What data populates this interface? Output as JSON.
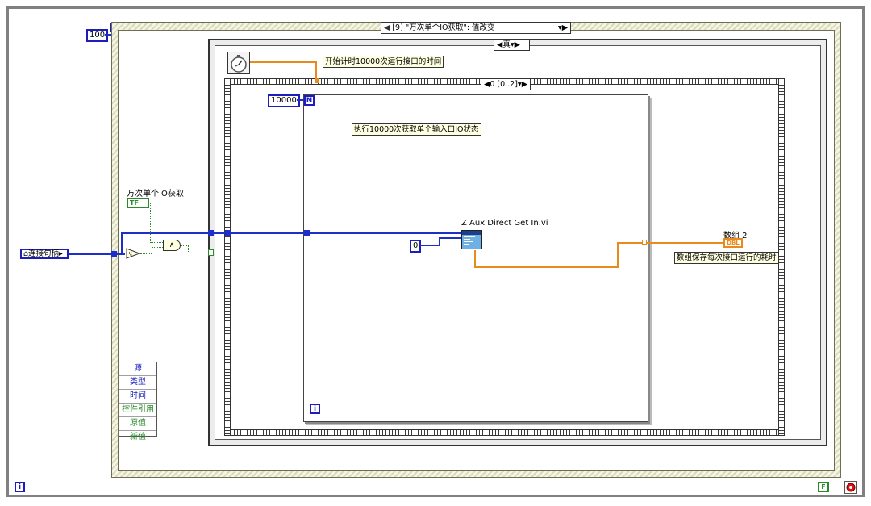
{
  "loop_count_const": "100",
  "event_structure": {
    "case_selector": "[9] \"万次单个IO获取\": 值改变"
  },
  "case_structure": {
    "selector": "真"
  },
  "sequence": {
    "frame_selector": "0 [0..2]"
  },
  "comments": {
    "timer_comment": "开始计时10000次运行接口的时间",
    "loop_comment": "执行10000次获取单个输入口IO状态",
    "array_comment": "数组保存每次接口运行的耗时"
  },
  "for_loop": {
    "count_const": "10000",
    "n_terminal": "N",
    "i_terminal": "i"
  },
  "subvi": {
    "name": "Z Aux Direct Get In.vi",
    "input_const": "0"
  },
  "array_indicator": {
    "label": "数组 2",
    "type": "DBL"
  },
  "bool_control": {
    "label": "万次单个IO获取",
    "type": "TF"
  },
  "handle_control": {
    "label": "连接句柄"
  },
  "event_data_nodes": [
    "源",
    "类型",
    "时间",
    "控件引用",
    "原值",
    "新值"
  ],
  "while_loop": {
    "i_terminal": "i",
    "stop_const": "F"
  },
  "colors": {
    "int_wire": "#1d2fc8",
    "dbl_wire": "#e88a1c",
    "bool_wire": "#2a8a2a"
  }
}
